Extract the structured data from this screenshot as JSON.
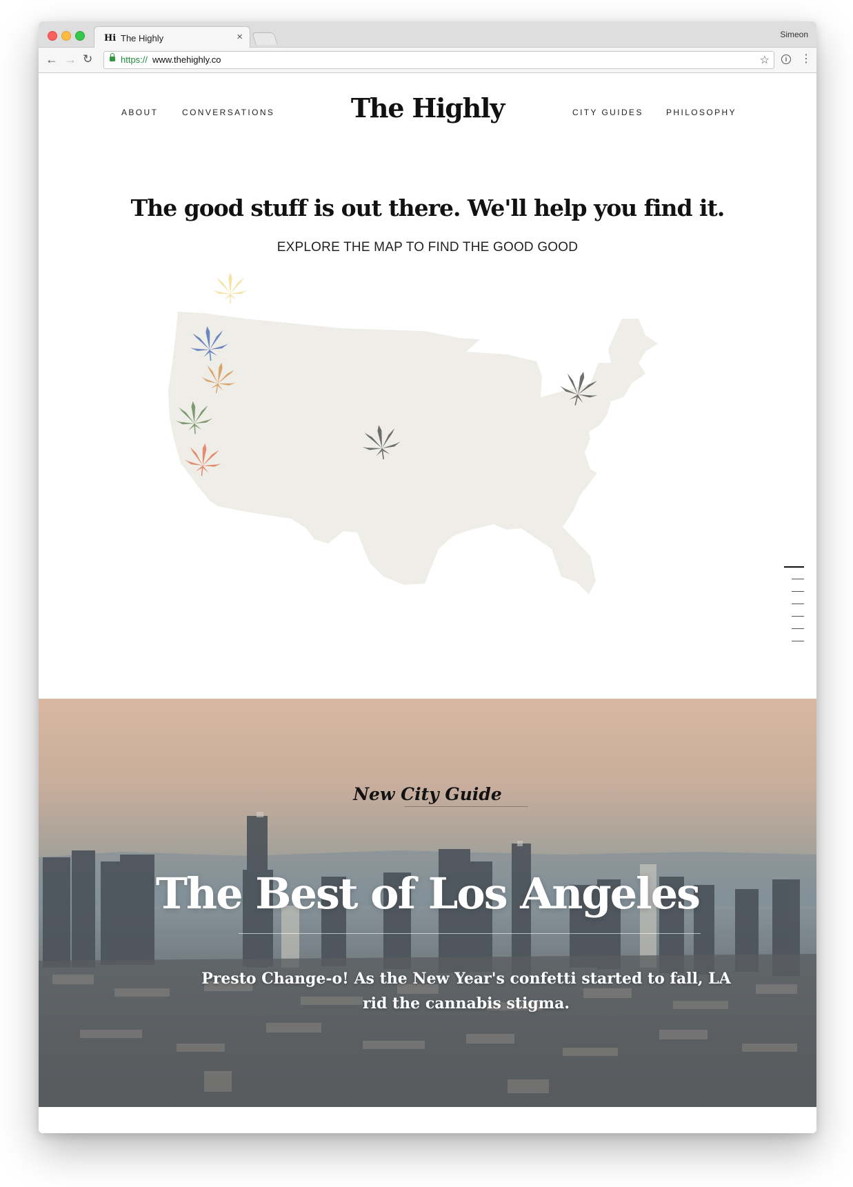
{
  "browser": {
    "tab_favicon": "Hi",
    "tab_title": "The Highly",
    "tab_close": "×",
    "profile": "Simeon",
    "url_scheme": "https://",
    "url_host": "www.thehighly.co",
    "back_icon": "←",
    "forward_icon": "→",
    "reload_icon": "↻",
    "star_icon": "☆",
    "ext_icon": "i",
    "menu_icon": "⋮"
  },
  "nav": {
    "logo": "The Highly",
    "left": [
      "ABOUT",
      "CONVERSATIONS"
    ],
    "right": [
      "CITY GUIDES",
      "PHILOSOPHY"
    ]
  },
  "intro": {
    "headline": "The good stuff is out there. We'll help you find it.",
    "subhead": "EXPLORE THE MAP TO FIND THE GOOD GOOD"
  },
  "map": {
    "fill_color": "#efede7",
    "markers": [
      {
        "name": "leaf-marker-yellow",
        "color": "#f4e3a4"
      },
      {
        "name": "leaf-marker-blue",
        "color": "#6d86c0"
      },
      {
        "name": "leaf-marker-tan",
        "color": "#d9a36c"
      },
      {
        "name": "leaf-marker-green",
        "color": "#7e9a73"
      },
      {
        "name": "leaf-marker-coral",
        "color": "#e48b6c"
      },
      {
        "name": "leaf-marker-gray-center",
        "color": "#6e6e6e"
      },
      {
        "name": "leaf-marker-gray-east",
        "color": "#6e6e6e"
      }
    ]
  },
  "scroll_indicator": {
    "count": 7,
    "active_index": 0
  },
  "hero": {
    "eyebrow": "New City Guide",
    "title": "The Best of Los Angeles",
    "subtitle": "Presto Change-o! As the New Year's confetti started to fall, LA rid the cannabis stigma."
  }
}
